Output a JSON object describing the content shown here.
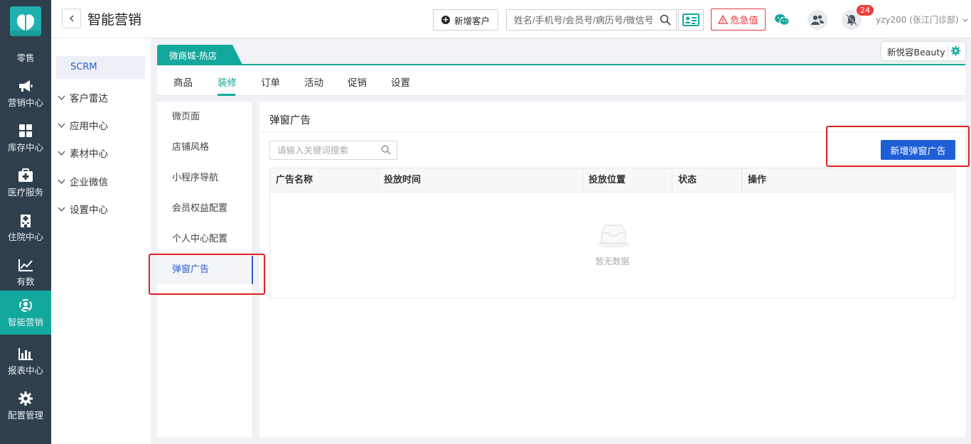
{
  "leftnav": {
    "items": [
      {
        "label": "零售",
        "icon": "shop-icon"
      },
      {
        "label": "营销中心",
        "icon": "megaphone-icon"
      },
      {
        "label": "库存中心",
        "icon": "grid-icon"
      },
      {
        "label": "医疗服务",
        "icon": "medkit-icon"
      },
      {
        "label": "住院中心",
        "icon": "hospital-icon"
      },
      {
        "label": "有数",
        "icon": "trend-icon"
      },
      {
        "label": "智能营销",
        "icon": "smart-marketing-icon"
      },
      {
        "label": "报表中心",
        "icon": "bar-chart-icon"
      },
      {
        "label": "配置管理",
        "icon": "gear-icon"
      }
    ],
    "active_color": "#13a89e",
    "bg_color": "#2f3f4e"
  },
  "header": {
    "title": "智能营销",
    "new_customer_label": "新增客户",
    "search_placeholder": "姓名/手机号/会员号/病历号/微信号",
    "danger_label": "危急值",
    "notification_count": "24",
    "user_label": "yzy200 (张江门诊部)"
  },
  "subnav": {
    "scrm_label": "SCRM",
    "groups": [
      "客户雷达",
      "应用中心",
      "素材中心",
      "企业微信",
      "设置中心"
    ]
  },
  "store": {
    "tab_label": "微商城-热店",
    "brand_label": "新悦容Beauty"
  },
  "tabs": [
    {
      "label": "商品"
    },
    {
      "label": "装修"
    },
    {
      "label": "订单"
    },
    {
      "label": "活动"
    },
    {
      "label": "促销"
    },
    {
      "label": "设置"
    }
  ],
  "menu": {
    "items": [
      "微页面",
      "店铺风格",
      "小程序导航",
      "会员权益配置",
      "个人中心配置",
      "弹窗广告"
    ]
  },
  "content": {
    "title": "弹窗广告",
    "keyword_placeholder": "请输入关键词搜索",
    "add_button": "新增弹窗广告",
    "columns": [
      "广告名称",
      "投放时间",
      "投放位置",
      "状态",
      "操作"
    ],
    "empty_text": "暂无数据"
  },
  "colors": {
    "accent": "#13a89e",
    "primary_button": "#1f5fd6",
    "danger": "#e23b3b",
    "annotation_red": "#e02020"
  }
}
